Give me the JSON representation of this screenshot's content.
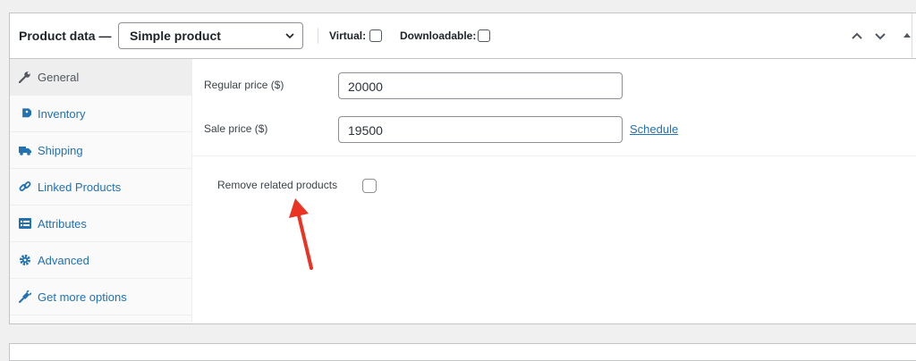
{
  "header": {
    "title": "Product data —",
    "product_type": "Simple product",
    "virtual_label": "Virtual:",
    "downloadable_label": "Downloadable:"
  },
  "sidebar": {
    "tabs": [
      {
        "label": "General",
        "icon": "wrench-icon",
        "active": true
      },
      {
        "label": "Inventory",
        "icon": "tag-icon",
        "active": false
      },
      {
        "label": "Shipping",
        "icon": "truck-icon",
        "active": false
      },
      {
        "label": "Linked Products",
        "icon": "link-icon",
        "active": false
      },
      {
        "label": "Attributes",
        "icon": "list-icon",
        "active": false
      },
      {
        "label": "Advanced",
        "icon": "gear-icon",
        "active": false
      },
      {
        "label": "Get more options",
        "icon": "plug-icon",
        "active": false
      }
    ]
  },
  "general": {
    "regular_price_label": "Regular price ($)",
    "regular_price_value": "20000",
    "sale_price_label": "Sale price ($)",
    "sale_price_value": "19500",
    "schedule_link": "Schedule",
    "remove_related_label": "Remove related products"
  },
  "colors": {
    "link": "#2271b1",
    "annotation_arrow": "#ea3323"
  }
}
